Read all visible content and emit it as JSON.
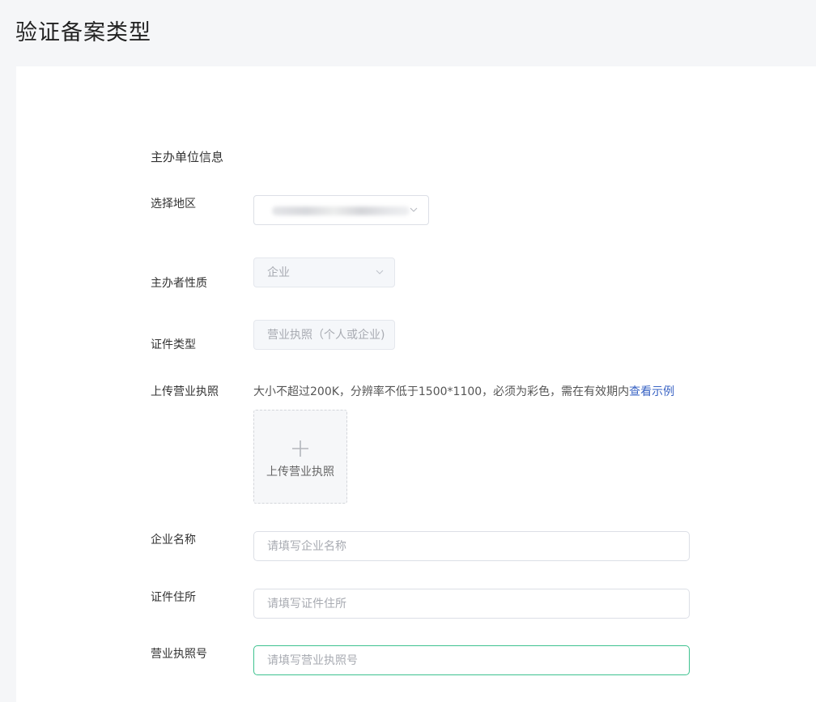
{
  "page": {
    "title": "验证备案类型"
  },
  "form": {
    "section_title": "主办单位信息",
    "region": {
      "label": "选择地区"
    },
    "organizer_nature": {
      "label": "主办者性质",
      "value": "企业"
    },
    "certificate_type": {
      "label": "证件类型",
      "value": "营业执照（个人或企业)"
    },
    "upload_license": {
      "label": "上传营业执照",
      "hint": "大小不超过200K，分辨率不低于1500*1100，必须为彩色，需在有效期内",
      "example_link": "查看示例",
      "button_label": "上传营业执照"
    },
    "company_name": {
      "label": "企业名称",
      "placeholder": "请填写企业名称"
    },
    "certificate_address": {
      "label": "证件住所",
      "placeholder": "请填写证件住所"
    },
    "license_number": {
      "label": "营业执照号",
      "placeholder": "请填写营业执照号"
    }
  },
  "colors": {
    "page_background": "#f5f6f8",
    "link": "#3a64c4",
    "focus_border": "#3ec28f"
  },
  "icons": [
    "chevron-down-icon",
    "plus-icon"
  ]
}
